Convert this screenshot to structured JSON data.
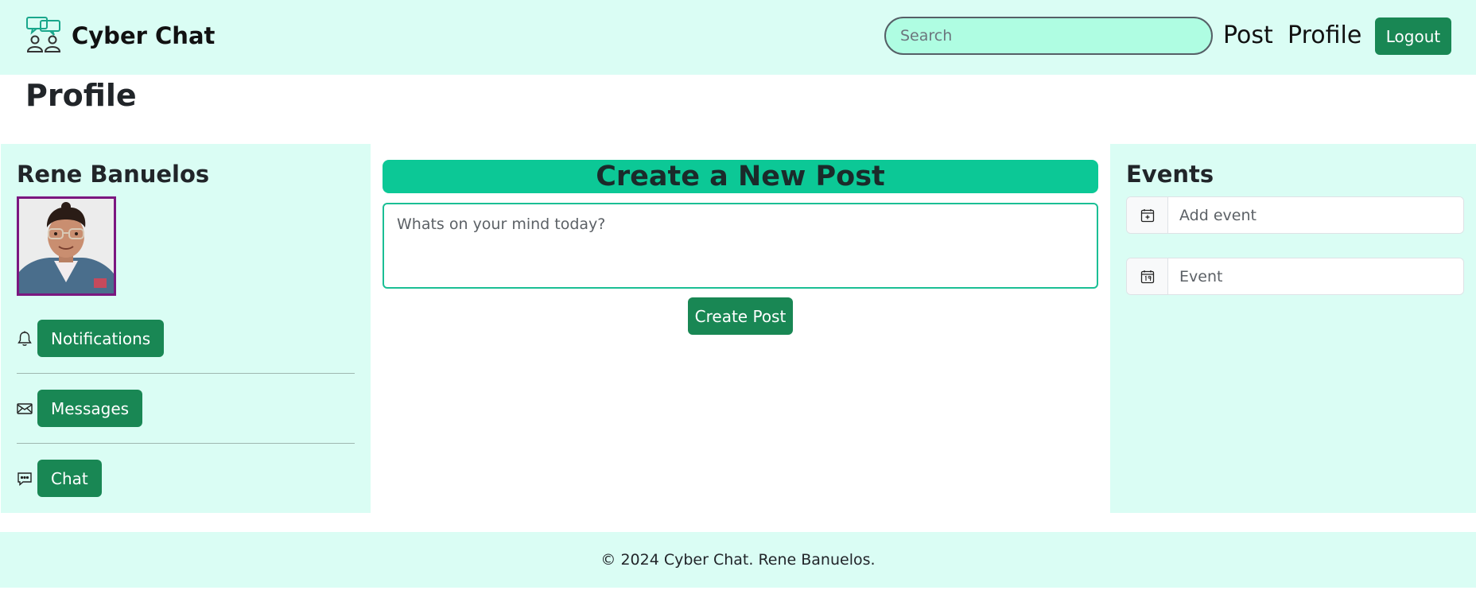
{
  "navbar": {
    "brand": "Cyber Chat",
    "brand_icon": "chat-users-icon",
    "search_placeholder": "Search",
    "links": [
      "Post",
      "Profile"
    ],
    "logout_label": "Logout"
  },
  "page": {
    "title": "Profile"
  },
  "profile": {
    "name": "Rene Banuelos",
    "actions": [
      {
        "label": "Notifications",
        "icon": "bell-icon"
      },
      {
        "label": "Messages",
        "icon": "envelope-icon"
      },
      {
        "label": "Chat",
        "icon": "chat-dots-icon"
      }
    ]
  },
  "create_post": {
    "heading": "Create a New Post",
    "placeholder": "Whats on your mind today?",
    "button_label": "Create Post"
  },
  "events": {
    "heading": "Events",
    "add_placeholder": "Add event",
    "event_placeholder": "Event"
  },
  "footer": {
    "text": "© 2024 Cyber Chat. Rene Banuelos."
  },
  "colors": {
    "accent_bg": "#dafdf4",
    "primary_button": "#198754",
    "post_header": "#0cc896",
    "avatar_border": "#7b1780"
  }
}
